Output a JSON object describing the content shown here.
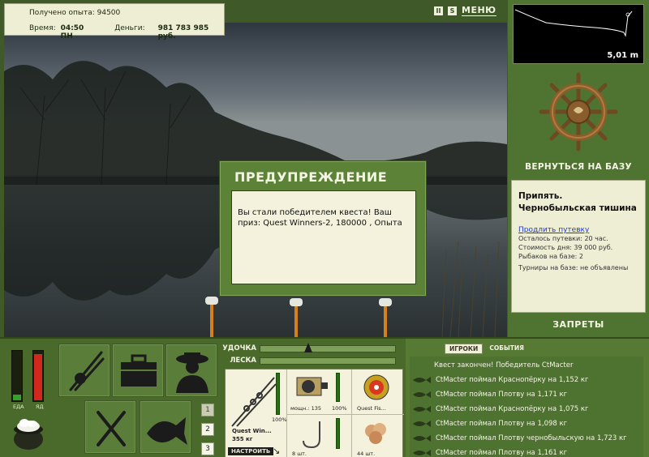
{
  "stats": {
    "experience_label": "Получено опыта:",
    "experience_value": "94500",
    "time_label": "Время:",
    "time_value": "04:50 ПН",
    "money_label": "Деньги:",
    "money_value": "981 783 985 руб."
  },
  "toolbar": {
    "pause_glyph": "II",
    "sound_glyph": "S",
    "menu_label": "МЕНЮ"
  },
  "depth": {
    "value": "5,01 m"
  },
  "right_panel": {
    "return_label": "ВЕРНУТЬСЯ НА БАЗУ",
    "location_line1": "Припять.",
    "location_line2": "Чернобыльская тишина",
    "extend_link": "Продлить путевку",
    "info_lines": [
      "Осталось путевки: 20 час.",
      "Стоимость дня: 39 000 руб.",
      "Рыбаков на базе: 2",
      "Турниры на базе: не объявлены"
    ],
    "bans_label": "ЗАПРЕТЫ"
  },
  "dialog": {
    "title": "ПРЕДУПРЕЖДЕНИЕ",
    "message": "Вы стали победителем квеста! Ваш приз: Quest Winners-2, 180000 , Опыта"
  },
  "needs": {
    "food_label": "ЕДА",
    "poison_label": "ЯД",
    "food_level": 0.12,
    "poison_level": 0.95
  },
  "pages": [
    "1",
    "2",
    "3"
  ],
  "tackle": {
    "rod_label": "УДОЧКА",
    "line_label": "ЛЕСКА",
    "rod_name": "Quest Win...",
    "rod_weight": "355 кг",
    "rod_percent": "100%",
    "reel_power": "мощн.: 135",
    "reel_percent": "100%",
    "line_name": "Quest Fis...",
    "hook_count": "8 шт.",
    "bait_count": "44 шт.",
    "setup_label": "НАСТРОИТЬ"
  },
  "chat": {
    "tabs": [
      "ИГРОКИ",
      "СОБЫТИЯ"
    ],
    "header": "Квест закончен! Победитель CtMacter",
    "lines": [
      "CtMacter поймал Краснопёрку на 1,152 кг",
      "CtMacter поймал Плотву на 1,171 кг",
      "CtMacter поймал Краснопёрку на 1,075 кг",
      "CtMacter поймал Плотву на 1,098 кг",
      "CtMacter поймал Плотву чернобыльскую на 1,723 кг",
      "CtMacter поймал Плотву на 1,161 кг"
    ]
  }
}
